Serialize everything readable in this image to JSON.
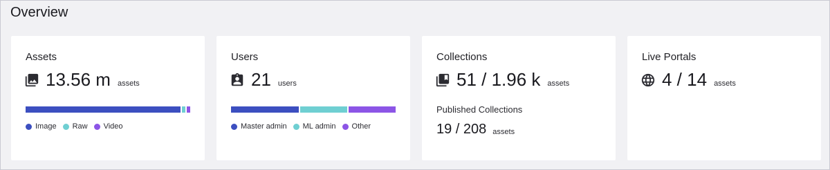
{
  "header": {
    "title": "Overview"
  },
  "colors": {
    "image": "#3c4fc0",
    "raw": "#6fcfd2",
    "video": "#8c55e6",
    "master_admin": "#3c4fc0",
    "ml_admin": "#6fcfd2",
    "other": "#8c55e6"
  },
  "cards": {
    "assets": {
      "title": "Assets",
      "icon": "photo-library-icon",
      "value": "13.56 m",
      "unit": "assets",
      "breakdown": [
        {
          "label": "Image",
          "fraction": 0.96,
          "color": "#3c4fc0"
        },
        {
          "label": "Raw",
          "fraction": 0.02,
          "color": "#6fcfd2"
        },
        {
          "label": "Video",
          "fraction": 0.02,
          "color": "#8c55e6"
        }
      ]
    },
    "users": {
      "title": "Users",
      "icon": "user-badge-icon",
      "value": "21",
      "unit": "users",
      "breakdown": [
        {
          "label": "Master admin",
          "fraction": 0.42,
          "color": "#3c4fc0"
        },
        {
          "label": "ML admin",
          "fraction": 0.29,
          "color": "#6fcfd2"
        },
        {
          "label": "Other",
          "fraction": 0.29,
          "color": "#8c55e6"
        }
      ]
    },
    "collections": {
      "title": "Collections",
      "icon": "collections-icon",
      "value": "51 / 1.96 k",
      "unit": "assets",
      "published": {
        "title": "Published Collections",
        "value": "19 / 208",
        "unit": "assets"
      }
    },
    "live_portals": {
      "title": "Live Portals",
      "icon": "globe-icon",
      "value": "4 / 14",
      "unit": "assets"
    }
  }
}
